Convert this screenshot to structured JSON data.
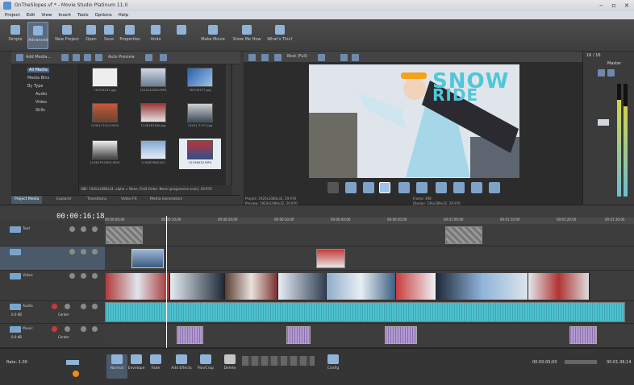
{
  "window": {
    "title": "OnTheSlopes.vf * - Movie Studio Platinum 11.0",
    "min": "–",
    "max": "▫",
    "close": "×"
  },
  "menu": [
    "Project",
    "Edit",
    "View",
    "Insert",
    "Tools",
    "Options",
    "Help"
  ],
  "toolbar": [
    {
      "label": "Simple"
    },
    {
      "label": "Advanced"
    },
    {
      "label": "New Project"
    },
    {
      "label": "Open"
    },
    {
      "label": "Save"
    },
    {
      "label": "Properties"
    },
    {
      "label": "Undo"
    },
    {
      "label": ""
    },
    {
      "label": "Make Movie"
    },
    {
      "label": "Show Me How"
    },
    {
      "label": "What's This?"
    }
  ],
  "media_panel": {
    "add_media": "Add Media...",
    "auto_preview": "Auto Preview",
    "tree": [
      "All Media",
      "Media Bins",
      "By Type",
      "Audio",
      "Video",
      "Stills"
    ],
    "thumbs": [
      {
        "cap": "7D7H0201.jpg"
      },
      {
        "cap": "121231GSIO.MP4"
      },
      {
        "cap": "7D7H0277.jpg"
      },
      {
        "cap": "1240117CLO.MOV"
      },
      {
        "cap": "12481B1DAi.jpg"
      },
      {
        "cap": "12421.77G7.jpg"
      },
      {
        "cap": "12481P1260G.MOV"
      },
      {
        "cap": "1240B7NBY.AVC"
      },
      {
        "cap": "12156032.MP4"
      }
    ],
    "info": "SBE: 1920x1080x24, alpha = None, Field Order: None (progressive scan), 29.970",
    "tabs": [
      "Project Media",
      "Explorer",
      "Transitions",
      "Video FX",
      "Media Generators"
    ]
  },
  "preview": {
    "quality": "Best (Full)",
    "title1": "SNOW",
    "title2": "RIDE",
    "project": "Project: 1920x1080x32, 29.970",
    "preview": "Preview: 1920x1080x32, 29.970",
    "frame": "Frame: 498",
    "display": "Display: 336x189x32, 29.970"
  },
  "master": {
    "label": "Master",
    "value": "16 / 16"
  },
  "timeline": {
    "timecode": "00:00:16;18",
    "ruler": [
      "00:00:00;00",
      "00:00:10;00",
      "00:00:20;00",
      "00:00:30;00",
      "00:00:40;00",
      "00:00:50;00",
      "00:01:00;00",
      "00:01:10;00",
      "00:01:20;00",
      "00:01:30;00"
    ],
    "tracks": [
      {
        "name": "Text"
      },
      {
        "name": ""
      },
      {
        "name": "Video"
      },
      {
        "name": "Audio"
      },
      {
        "name": "Music"
      }
    ],
    "audio_level": "0.0 dB",
    "audio_pan": "Center",
    "music_level": "0.0 dB",
    "music_pan": "Center"
  },
  "bottom": {
    "rate": "Rate: 1.00",
    "buttons": [
      "Normal",
      "Envelope",
      "Fade",
      "Add Effects",
      "Pan/Crop",
      "Delete",
      "Config"
    ],
    "end_time": "00:01:36;14"
  }
}
